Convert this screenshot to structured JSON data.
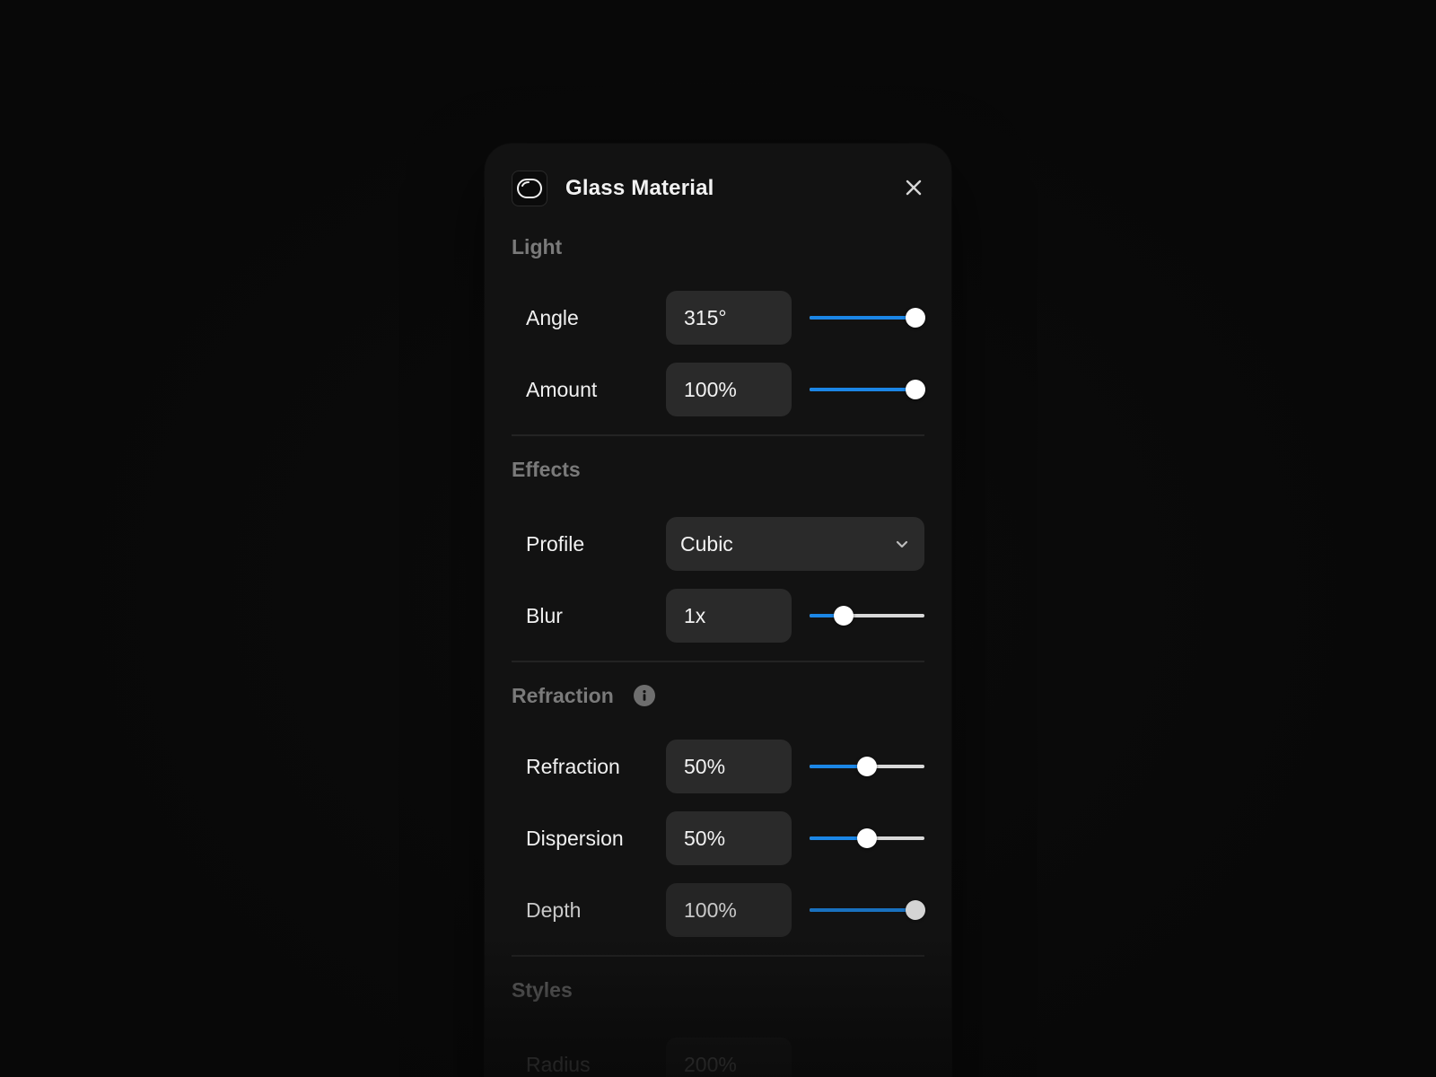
{
  "panel": {
    "title": "Glass Material",
    "header_icon": "glass-material-icon",
    "close_icon": "close-icon"
  },
  "sections": {
    "light": {
      "title": "Light",
      "rows": [
        {
          "label": "Angle",
          "value": "315°",
          "slider_fraction": 0.92
        },
        {
          "label": "Amount",
          "value": "100%",
          "slider_fraction": 0.92
        }
      ]
    },
    "effects": {
      "title": "Effects",
      "profile": {
        "label": "Profile",
        "value": "Cubic"
      },
      "blur": {
        "label": "Blur",
        "value": "1x",
        "slider_fraction": 0.3
      }
    },
    "refraction": {
      "title": "Refraction",
      "info_icon": "info-icon",
      "rows": [
        {
          "label": "Refraction",
          "value": "50%",
          "slider_fraction": 0.5
        },
        {
          "label": "Dispersion",
          "value": "50%",
          "slider_fraction": 0.5
        },
        {
          "label": "Depth",
          "value": "100%",
          "slider_fraction": 0.92
        }
      ]
    },
    "styles": {
      "title": "Styles",
      "partial_row": {
        "label": "Radius",
        "value": "200%"
      }
    }
  },
  "colors": {
    "accent": "#1b86e6",
    "panel_bg": "#121212",
    "field_bg": "#2a2a2a",
    "section_title": "#7a7a7a"
  }
}
